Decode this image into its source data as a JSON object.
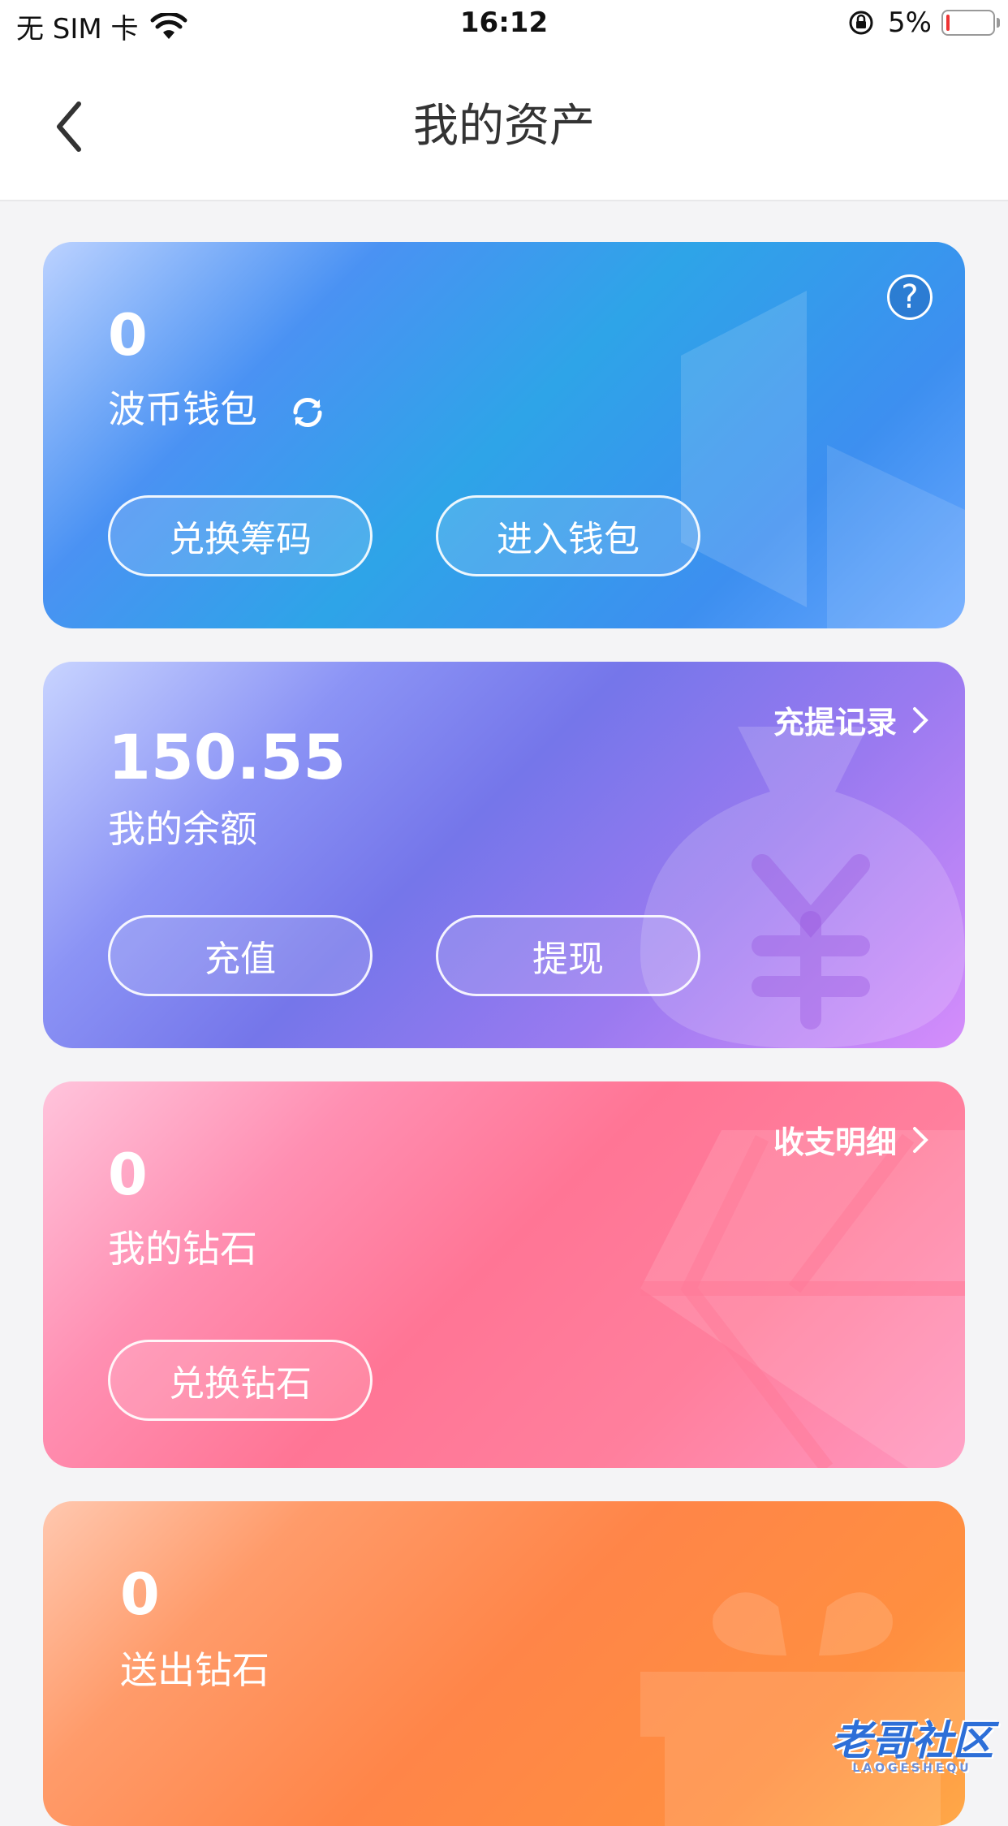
{
  "status_bar": {
    "carrier": "无 SIM 卡",
    "time": "16:12",
    "battery": "5%"
  },
  "header": {
    "title": "我的资产"
  },
  "cards": {
    "wallet": {
      "value": "0",
      "label": "波币钱包",
      "buttons": [
        "兑换筹码",
        "进入钱包"
      ],
      "help": "?"
    },
    "balance": {
      "value": "150.55",
      "label": "我的余额",
      "link": "充提记录",
      "buttons": [
        "充值",
        "提现"
      ]
    },
    "diamond": {
      "value": "0",
      "label": "我的钻石",
      "link": "收支明细",
      "buttons": [
        "兑换钻石"
      ]
    },
    "sent": {
      "value": "0",
      "label": "送出钻石"
    }
  },
  "watermark": {
    "text": "老哥社区",
    "sub": "LAOGESHEQU"
  },
  "colors": {
    "wallet_accent": "#2ea4e8",
    "balance_accent": "#7576ea",
    "diamond_accent": "#ff7595",
    "sent_accent": "#ff8548"
  }
}
